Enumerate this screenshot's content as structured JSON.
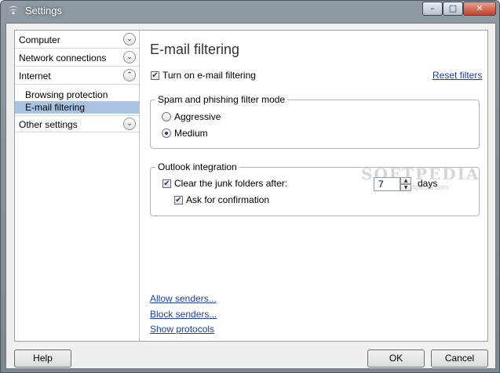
{
  "window": {
    "title": "Settings",
    "controls": {
      "minimize": "–",
      "maximize": "□",
      "close": "✕"
    }
  },
  "sidebar": {
    "categories": [
      {
        "label": "Computer",
        "chevron": "down"
      },
      {
        "label": "Network connections",
        "chevron": "down"
      },
      {
        "label": "Internet",
        "chevron": "up"
      },
      {
        "label": "Other settings",
        "chevron": "down"
      }
    ],
    "internet_items": [
      {
        "label": "Browsing protection",
        "selected": false
      },
      {
        "label": "E-mail filtering",
        "selected": true
      }
    ]
  },
  "main": {
    "title": "E-mail filtering",
    "turn_on": {
      "label": "Turn on e-mail filtering",
      "checked": true
    },
    "reset_link": "Reset filters",
    "spam_group": {
      "legend": "Spam and phishing filter mode",
      "options": [
        {
          "label": "Aggressive",
          "selected": false
        },
        {
          "label": "Medium",
          "selected": true
        }
      ]
    },
    "outlook_group": {
      "legend": "Outlook integration",
      "clear_junk": {
        "label": "Clear the junk folders after:",
        "checked": true
      },
      "days_value": "7",
      "days_unit": "days",
      "confirm": {
        "label": "Ask for confirmation",
        "checked": true
      }
    },
    "links": [
      "Allow senders...",
      "Block senders...",
      "Show protocols"
    ],
    "watermark": "SOFTPEDIA",
    "watermark_sub": "www.softpedia.com"
  },
  "footer": {
    "help": "Help",
    "ok": "OK",
    "cancel": "Cancel"
  },
  "colors": {
    "selection": "#a9c4e2",
    "link": "#1b3fa0"
  }
}
